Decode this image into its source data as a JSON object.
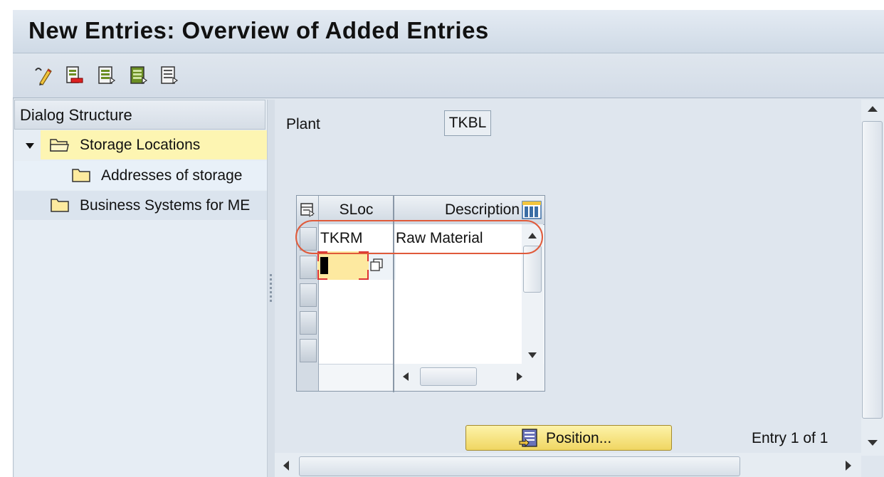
{
  "window": {
    "title": "New Entries: Overview of Added Entries"
  },
  "toolbar": {
    "buttons": [
      {
        "icon": "display-change-icon"
      },
      {
        "icon": "delete-row-icon"
      },
      {
        "icon": "previous-entry-icon"
      },
      {
        "icon": "next-entry-icon"
      },
      {
        "icon": "select-all-icon"
      }
    ]
  },
  "dialog_structure": {
    "header": "Dialog Structure",
    "items": [
      {
        "label": "Storage Locations",
        "icon": "folder-open-icon",
        "expanded": true,
        "selected": true
      },
      {
        "label": "Addresses of storage",
        "icon": "folder-icon",
        "indent": true
      },
      {
        "label": "Business Systems for ME",
        "icon": "folder-icon"
      }
    ]
  },
  "form": {
    "plant_label": "Plant",
    "plant_value": "TKBL"
  },
  "table": {
    "columns": [
      "SLoc",
      "Description"
    ],
    "rows": [
      {
        "sloc": "TKRM",
        "description": "Raw Material"
      },
      {
        "sloc": "",
        "description": ""
      },
      {
        "sloc": "",
        "description": ""
      },
      {
        "sloc": "",
        "description": ""
      },
      {
        "sloc": "",
        "description": ""
      }
    ]
  },
  "footer": {
    "position_button": "Position...",
    "entry_info": "Entry 1 of 1"
  },
  "colors": {
    "highlight_annotation": "#e05a3a",
    "selected_tree_item": "#fdf5b2",
    "button_yellow": "#f6e27f"
  }
}
